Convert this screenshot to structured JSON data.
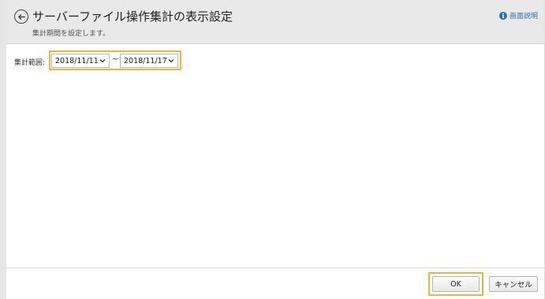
{
  "header": {
    "title": "サーバーファイル操作集計の表示設定",
    "subtitle": "集計期間を設定します。",
    "help_label": "画面説明"
  },
  "form": {
    "range_label": "集計範囲:",
    "start_date": "2018/11/11",
    "separator": "~",
    "end_date": "2018/11/17"
  },
  "footer": {
    "ok_label": "OK",
    "cancel_label": "キャンセル"
  },
  "colors": {
    "highlight": "#f0b43c",
    "header_bg": "#e9e9e9",
    "link": "#2a6fb0"
  },
  "icons": {
    "back": "back-arrow-circle-icon",
    "help": "info-icon",
    "dropdown": "chevron-down-icon"
  }
}
